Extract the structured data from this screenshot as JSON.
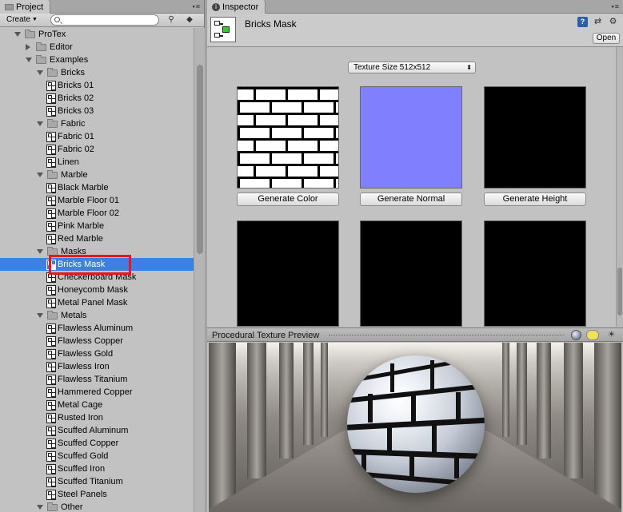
{
  "project": {
    "tab_label": "Project",
    "create_label": "Create",
    "search_placeholder": "",
    "tree": [
      {
        "label": "ProTex",
        "depth": 0,
        "type": "folder",
        "open": true
      },
      {
        "label": "Editor",
        "depth": 1,
        "type": "folder",
        "open": false
      },
      {
        "label": "Examples",
        "depth": 1,
        "type": "folder",
        "open": true
      },
      {
        "label": "Bricks",
        "depth": 2,
        "type": "folder",
        "open": true
      },
      {
        "label": "Bricks 01",
        "depth": 3,
        "type": "asset"
      },
      {
        "label": "Bricks 02",
        "depth": 3,
        "type": "asset"
      },
      {
        "label": "Bricks 03",
        "depth": 3,
        "type": "asset"
      },
      {
        "label": "Fabric",
        "depth": 2,
        "type": "folder",
        "open": true
      },
      {
        "label": "Fabric 01",
        "depth": 3,
        "type": "asset"
      },
      {
        "label": "Fabric 02",
        "depth": 3,
        "type": "asset"
      },
      {
        "label": "Linen",
        "depth": 3,
        "type": "asset"
      },
      {
        "label": "Marble",
        "depth": 2,
        "type": "folder",
        "open": true
      },
      {
        "label": "Black Marble",
        "depth": 3,
        "type": "asset"
      },
      {
        "label": "Marble Floor 01",
        "depth": 3,
        "type": "asset"
      },
      {
        "label": "Marble Floor 02",
        "depth": 3,
        "type": "asset"
      },
      {
        "label": "Pink Marble",
        "depth": 3,
        "type": "asset"
      },
      {
        "label": "Red Marble",
        "depth": 3,
        "type": "asset"
      },
      {
        "label": "Masks",
        "depth": 2,
        "type": "folder",
        "open": true
      },
      {
        "label": "Bricks Mask",
        "depth": 3,
        "type": "asset",
        "selected": true
      },
      {
        "label": "Checkerboard Mask",
        "depth": 3,
        "type": "asset"
      },
      {
        "label": "Honeycomb Mask",
        "depth": 3,
        "type": "asset"
      },
      {
        "label": "Metal Panel Mask",
        "depth": 3,
        "type": "asset"
      },
      {
        "label": "Metals",
        "depth": 2,
        "type": "folder",
        "open": true
      },
      {
        "label": "Flawless Aluminum",
        "depth": 3,
        "type": "asset"
      },
      {
        "label": "Flawless Copper",
        "depth": 3,
        "type": "asset"
      },
      {
        "label": "Flawless Gold",
        "depth": 3,
        "type": "asset"
      },
      {
        "label": "Flawless Iron",
        "depth": 3,
        "type": "asset"
      },
      {
        "label": "Flawless Titanium",
        "depth": 3,
        "type": "asset"
      },
      {
        "label": "Hammered Copper",
        "depth": 3,
        "type": "asset"
      },
      {
        "label": "Metal Cage",
        "depth": 3,
        "type": "asset"
      },
      {
        "label": "Rusted Iron",
        "depth": 3,
        "type": "asset"
      },
      {
        "label": "Scuffed Aluminum",
        "depth": 3,
        "type": "asset"
      },
      {
        "label": "Scuffed Copper",
        "depth": 3,
        "type": "asset"
      },
      {
        "label": "Scuffed Gold",
        "depth": 3,
        "type": "asset"
      },
      {
        "label": "Scuffed Iron",
        "depth": 3,
        "type": "asset"
      },
      {
        "label": "Scuffed Titanium",
        "depth": 3,
        "type": "asset"
      },
      {
        "label": "Steel Panels",
        "depth": 3,
        "type": "asset"
      },
      {
        "label": "Other",
        "depth": 2,
        "type": "folder",
        "open": true
      }
    ]
  },
  "inspector": {
    "tab_label": "Inspector",
    "asset_title": "Bricks Mask",
    "open_label": "Open",
    "texture_size_label": "Texture Size 512x512",
    "generate_color_label": "Generate Color",
    "generate_normal_label": "Generate Normal",
    "generate_height_label": "Generate Height",
    "preview_title": "Procedural Texture Preview"
  },
  "colors": {
    "selection": "#3d80df",
    "highlight_box": "#e4191c",
    "normal_map": "#8080fe"
  }
}
